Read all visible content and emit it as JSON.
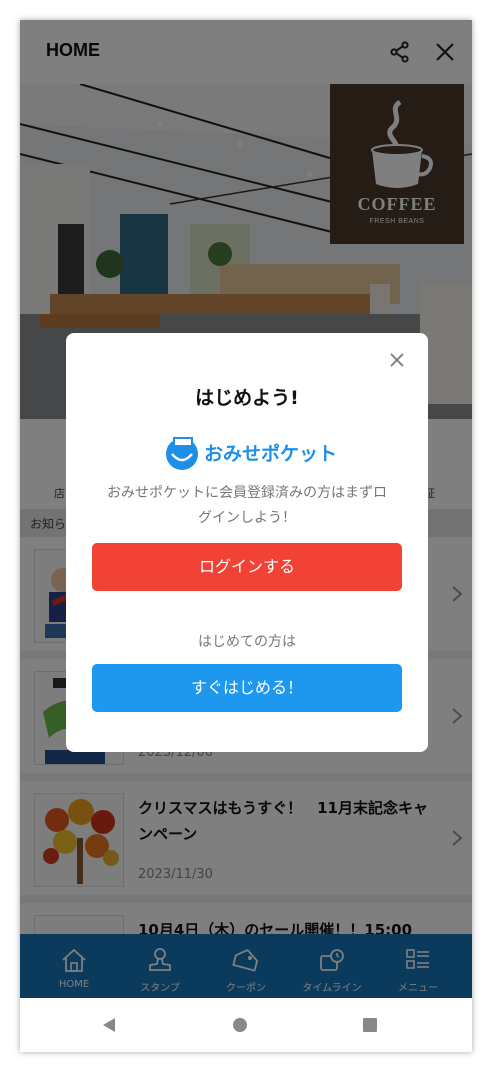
{
  "header": {
    "title": "HOME"
  },
  "hero": {
    "logo_text": "COFFEE",
    "logo_sub": "FRESH BEANS"
  },
  "icon_row": {
    "label_left": "店",
    "label_right": "証"
  },
  "section": {
    "title": "お知ら"
  },
  "news": [
    {
      "title": "",
      "date": ""
    },
    {
      "title": "",
      "date": "2023/12/06"
    },
    {
      "title": "クリスマスはもうすぐ！　11月末記念キャンペーン",
      "date": "2023/11/30"
    },
    {
      "title": "10月4日（木）のセール開催！！15:00",
      "date": ""
    }
  ],
  "nav": [
    {
      "label": "HOME",
      "icon": "home-icon"
    },
    {
      "label": "スタンプ",
      "icon": "stamp-icon"
    },
    {
      "label": "クーポン",
      "icon": "coupon-icon"
    },
    {
      "label": "タイムライン",
      "icon": "timeline-icon"
    },
    {
      "label": "メニュー",
      "icon": "menu-icon"
    }
  ],
  "modal": {
    "title": "はじめよう!",
    "brand": "おみせポケット",
    "message": "おみせポケットに会員登録済みの方はまずログインしよう！",
    "login_label": "ログインする",
    "first_time": "はじめての方は",
    "start_label": "すぐはじめる！"
  },
  "colors": {
    "login": "#f24135",
    "start": "#1e97ee",
    "nav": "#1576b9",
    "brand": "#1e8fe6"
  }
}
